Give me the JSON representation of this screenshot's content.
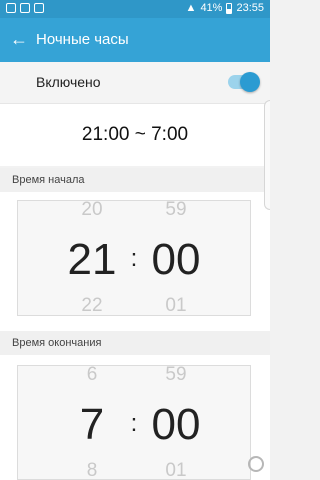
{
  "status": {
    "battery": "41%",
    "time": "23:55"
  },
  "header": {
    "title": "Ночные часы"
  },
  "toggle": {
    "label": "Включено",
    "on": true
  },
  "summary": {
    "range": "21:00 ~ 7:00"
  },
  "start": {
    "section_label": "Время начала",
    "hour_prev": "20",
    "hour": "21",
    "hour_next": "22",
    "minute_prev": "59",
    "minute": "00",
    "minute_next": "01",
    "separator": ":"
  },
  "end": {
    "section_label": "Время окончания",
    "hour_prev": "6",
    "hour": "7",
    "hour_next": "8",
    "minute_prev": "59",
    "minute": "00",
    "minute_next": "01",
    "separator": ":"
  },
  "icons": [
    "back-arrow-icon",
    "signal-icon",
    "wifi-icon",
    "battery-icon"
  ],
  "colors": {
    "accent": "#35a3d6",
    "status_bar": "#2f97c8"
  }
}
